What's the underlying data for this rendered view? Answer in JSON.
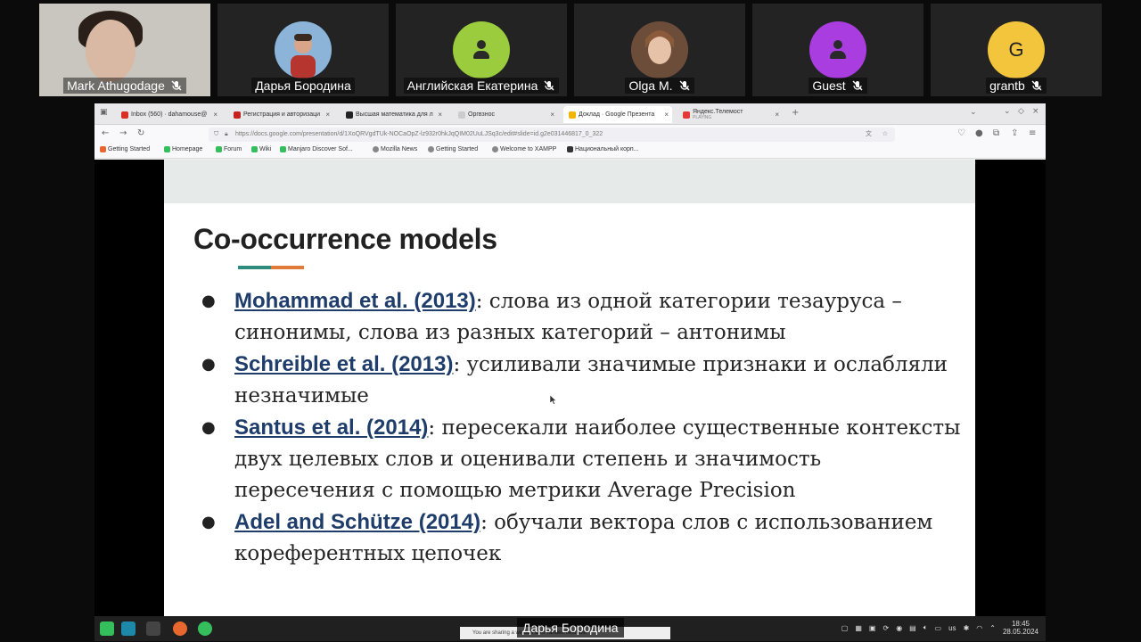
{
  "participants": [
    {
      "name": "Mark Athugodage",
      "type": "camera"
    },
    {
      "name": "Дарья Бородина",
      "type": "photo"
    },
    {
      "name": "Английская Екатерина",
      "type": "icon",
      "color": "#9bcc3d"
    },
    {
      "name": "Olga M.",
      "type": "photo"
    },
    {
      "name": "Guest",
      "type": "icon",
      "color": "#a93de0"
    },
    {
      "name": "grantb",
      "type": "letter",
      "letter": "G",
      "color": "#f2c53c"
    }
  ],
  "browser": {
    "tabs": [
      {
        "label": "Inbox (560) · dahamouse@",
        "color": "#d93025"
      },
      {
        "label": "Регистрация и авторизаци",
        "color": "#c5221f"
      },
      {
        "label": "Высшая математика для л",
        "color": "#222"
      },
      {
        "label": "Оргвзнос",
        "color": "#777"
      },
      {
        "label": "Доклад · Google Презента",
        "color": "#f4b400"
      },
      {
        "label": "Яндекс.Телемост",
        "sublabel": "PLAYING",
        "color": "#e53935"
      }
    ],
    "url": "https://docs.google.com/presentation/d/1XoQRVgdTUk-NOCaOpZ-lz932r0hkJqQIM02UuLJSq3c/edit#slide=id.g2e031446817_0_322",
    "bookmarks": [
      {
        "label": "Getting Started",
        "color": "#e8672f"
      },
      {
        "label": "Homepage",
        "color": "#35bf5c"
      },
      {
        "label": "Forum",
        "color": "#35bf5c"
      },
      {
        "label": "Wiki",
        "color": "#35bf5c"
      },
      {
        "label": "Manjaro Discover Sof...",
        "color": "#35bf5c"
      },
      {
        "label": "Mozilla News",
        "color": "#666"
      },
      {
        "label": "Getting Started",
        "color": "#666"
      },
      {
        "label": "Welcome to XAMPP",
        "color": "#666"
      },
      {
        "label": "Национальный корп...",
        "color": "#333"
      }
    ]
  },
  "slide": {
    "title": "Co-occurrence models",
    "bullets": [
      {
        "ref": "Mohammad et al. (2013)",
        "text": ": слова из одной категории тезауруса – синонимы, слова из разных категорий – антонимы"
      },
      {
        "ref": "Schreible et al. (2013)",
        "text": ": усиливали значимые признаки и ослабляли незначимые"
      },
      {
        "ref": "Santus et al. (2014)",
        "text": ": пересекали наиболее существенные контексты двух целевых слов и оценивали степень и значимость пересечения с помощью метрики Average Precision"
      },
      {
        "ref": "Adel and Schütze (2014)",
        "text": ": обучали вектора слов с использованием кореферентных цепочек"
      }
    ]
  },
  "taskbar": {
    "presenter": "Дарья Бородина",
    "notification": "You are sharing a window with Yandex.Telemost",
    "keyboard": "us",
    "time": "18:45",
    "date": "28.05.2024"
  }
}
